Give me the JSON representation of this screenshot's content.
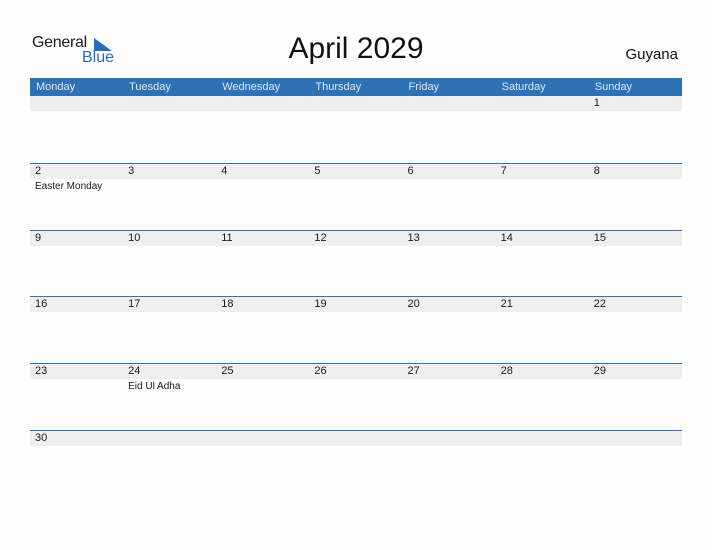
{
  "logo": {
    "line1": "General",
    "line2": "Blue",
    "accent": "#2a6cb8"
  },
  "title": "April 2029",
  "country": "Guyana",
  "colors": {
    "header_bg": "#2e72b5",
    "band_bg": "#efefef"
  },
  "weekdays": [
    "Monday",
    "Tuesday",
    "Wednesday",
    "Thursday",
    "Friday",
    "Saturday",
    "Sunday"
  ],
  "weeks": [
    [
      {
        "d": "",
        "e": ""
      },
      {
        "d": "",
        "e": ""
      },
      {
        "d": "",
        "e": ""
      },
      {
        "d": "",
        "e": ""
      },
      {
        "d": "",
        "e": ""
      },
      {
        "d": "",
        "e": ""
      },
      {
        "d": "1",
        "e": ""
      }
    ],
    [
      {
        "d": "2",
        "e": "Easter Monday"
      },
      {
        "d": "3",
        "e": ""
      },
      {
        "d": "4",
        "e": ""
      },
      {
        "d": "5",
        "e": ""
      },
      {
        "d": "6",
        "e": ""
      },
      {
        "d": "7",
        "e": ""
      },
      {
        "d": "8",
        "e": ""
      }
    ],
    [
      {
        "d": "9",
        "e": ""
      },
      {
        "d": "10",
        "e": ""
      },
      {
        "d": "11",
        "e": ""
      },
      {
        "d": "12",
        "e": ""
      },
      {
        "d": "13",
        "e": ""
      },
      {
        "d": "14",
        "e": ""
      },
      {
        "d": "15",
        "e": ""
      }
    ],
    [
      {
        "d": "16",
        "e": ""
      },
      {
        "d": "17",
        "e": ""
      },
      {
        "d": "18",
        "e": ""
      },
      {
        "d": "19",
        "e": ""
      },
      {
        "d": "20",
        "e": ""
      },
      {
        "d": "21",
        "e": ""
      },
      {
        "d": "22",
        "e": ""
      }
    ],
    [
      {
        "d": "23",
        "e": ""
      },
      {
        "d": "24",
        "e": "Eid Ul Adha"
      },
      {
        "d": "25",
        "e": ""
      },
      {
        "d": "26",
        "e": ""
      },
      {
        "d": "27",
        "e": ""
      },
      {
        "d": "28",
        "e": ""
      },
      {
        "d": "29",
        "e": ""
      }
    ],
    [
      {
        "d": "30",
        "e": ""
      },
      {
        "d": "",
        "e": ""
      },
      {
        "d": "",
        "e": ""
      },
      {
        "d": "",
        "e": ""
      },
      {
        "d": "",
        "e": ""
      },
      {
        "d": "",
        "e": ""
      },
      {
        "d": "",
        "e": ""
      }
    ]
  ]
}
